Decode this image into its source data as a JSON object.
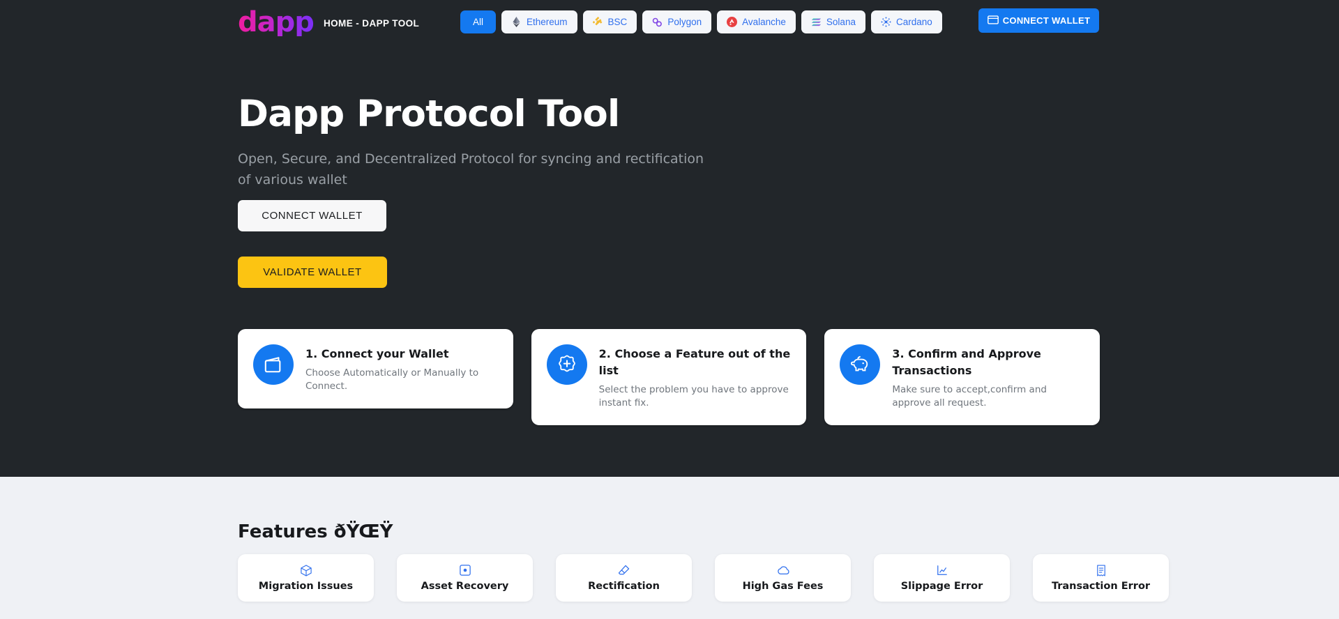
{
  "header": {
    "logo_text": "dapp",
    "brand_label": "HOME - DAPP TOOL",
    "connect_label": "CONNECT WALLET",
    "connect_icon": "wallet-icon",
    "chains": [
      {
        "label": "All",
        "icon": "none",
        "active": true
      },
      {
        "label": "Ethereum",
        "icon": "ethereum-icon",
        "active": false
      },
      {
        "label": "BSC",
        "icon": "binance-icon",
        "active": false
      },
      {
        "label": "Polygon",
        "icon": "polygon-icon",
        "active": false
      },
      {
        "label": "Avalanche",
        "icon": "avalanche-icon",
        "active": false
      },
      {
        "label": "Solana",
        "icon": "solana-icon",
        "active": false
      },
      {
        "label": "Cardano",
        "icon": "cardano-icon",
        "active": false
      }
    ]
  },
  "hero": {
    "title": "Dapp Protocol Tool",
    "subtitle": "Open, Secure, and Decentralized Protocol for syncing and rectification of various wallet",
    "connect_label": "CONNECT WALLET",
    "validate_label": "VALIDATE WALLET"
  },
  "steps": [
    {
      "title": "1. Connect your Wallet",
      "desc": "Choose Automatically or Manually to Connect.",
      "icon": "wallet-icon"
    },
    {
      "title": "2. Choose a Feature out of the list",
      "desc": "Select the problem you have to approve instant fix.",
      "icon": "badge-plus-icon"
    },
    {
      "title": "3. Confirm and Approve Transactions",
      "desc": "Make sure to accept,confirm and approve all request.",
      "icon": "piggy-bank-icon"
    }
  ],
  "features": {
    "heading": "Features ðŸŒŸ",
    "items": [
      {
        "label": "Migration Issues",
        "icon": "box-icon"
      },
      {
        "label": "Asset Recovery",
        "icon": "disc-icon"
      },
      {
        "label": "Rectification",
        "icon": "eraser-icon"
      },
      {
        "label": "High Gas Fees",
        "icon": "cloud-icon"
      },
      {
        "label": "Slippage Error",
        "icon": "chart-icon"
      },
      {
        "label": "Transaction Error",
        "icon": "receipt-icon"
      }
    ]
  },
  "colors": {
    "dark_bg": "#22262a",
    "light_bg": "#eff1f5",
    "accent_blue": "#1479f0",
    "chip_blue": "#2f6fed",
    "yellow": "#fcc412",
    "white": "#ffffff"
  }
}
